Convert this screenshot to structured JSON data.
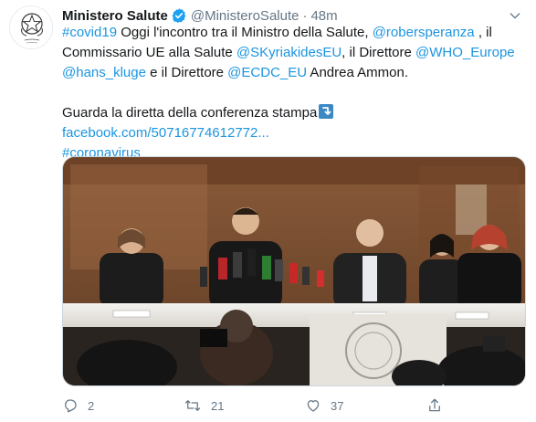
{
  "tweet": {
    "author_name": "Ministero Salute",
    "handle": "@MinisteroSalute",
    "separator": "·",
    "time": "48m",
    "body": {
      "l1_a": "#covid19",
      "l1_b": " Oggi l'incontro tra il Ministro della Salute, ",
      "l1_c": "@robersperanza",
      "l1_d": " , il",
      "l2_a": "Commissario UE alla Salute ",
      "l2_b": "@SKyriakidesEU",
      "l2_c": ", il Direttore ",
      "l2_d": "@WHO_Europe",
      "l3_a": "@hans_kluge",
      "l3_b": " e il Direttore ",
      "l3_c": "@ECDC_EU",
      "l3_d": "  Andrea Ammon.",
      "l4": "Guarda la diretta della conferenza stampa",
      "l5": "facebook.com/50716774612772...",
      "l6": "#coronavirus"
    },
    "actions": {
      "reply_count": "2",
      "retweet_count": "21",
      "like_count": "37"
    },
    "colors": {
      "link": "#1b95e0",
      "verified": "#1da1f2",
      "muted": "#657786"
    }
  }
}
